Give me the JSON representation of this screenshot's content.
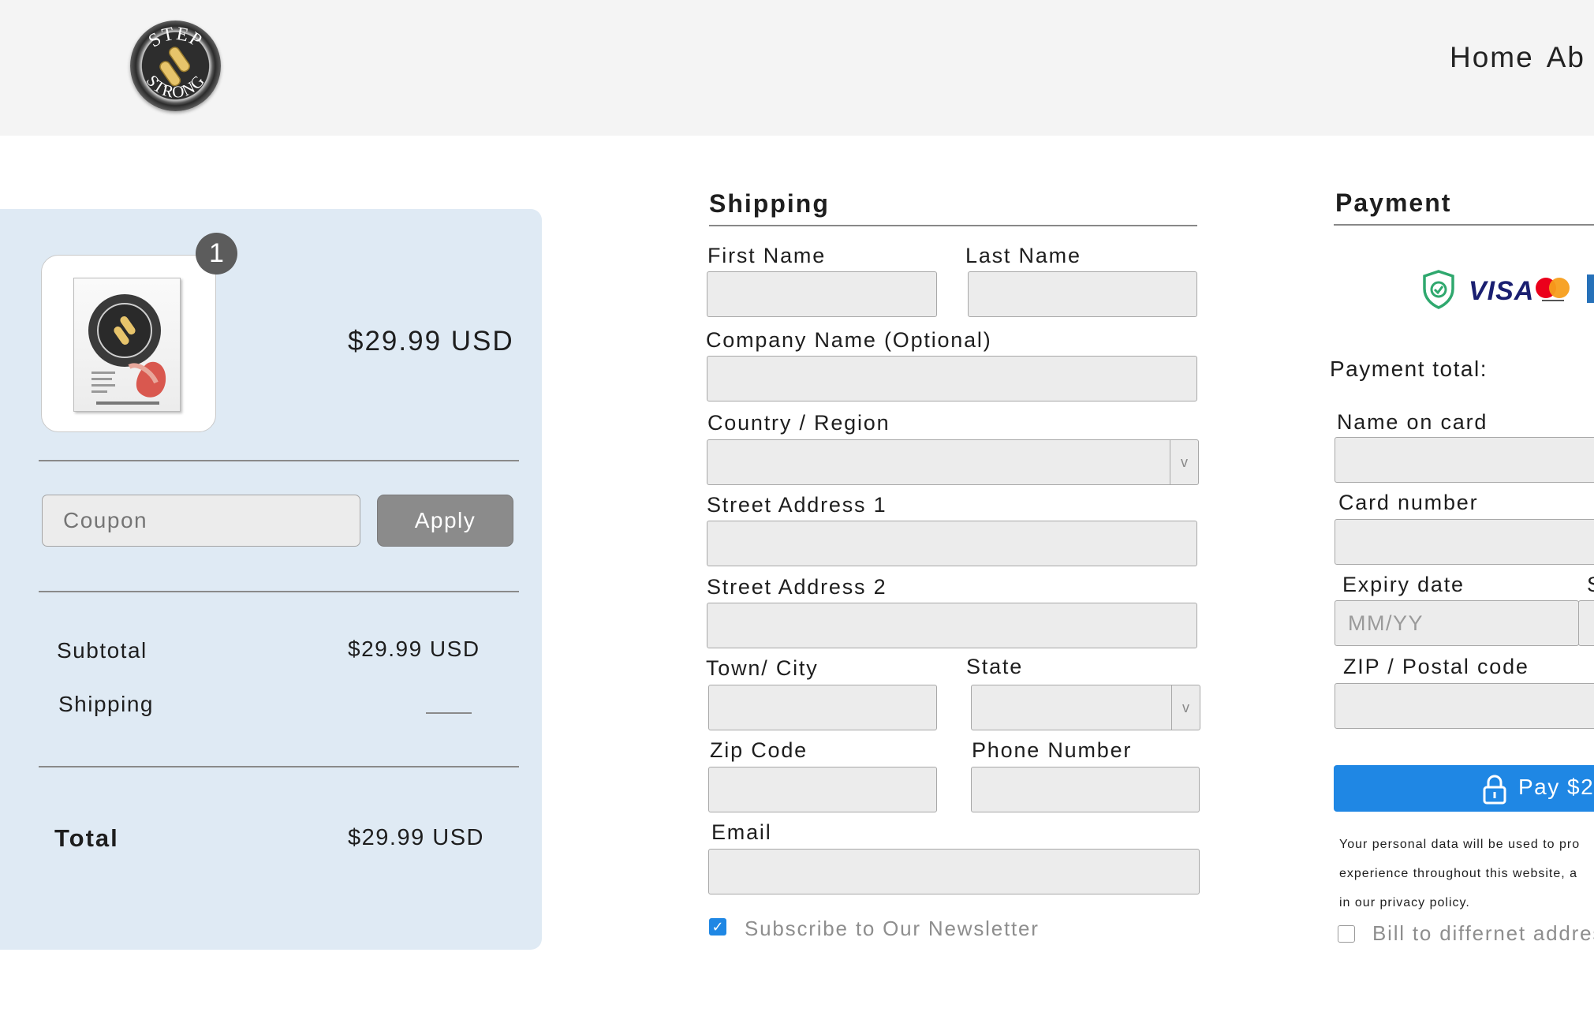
{
  "header": {
    "logo_text_top": "STEP",
    "logo_text_bottom": "STRONG",
    "nav": [
      "Home",
      "Ab"
    ]
  },
  "cart": {
    "item_count": "1",
    "product_price": "$29.99 USD",
    "coupon_placeholder": "Coupon",
    "apply_label": "Apply",
    "subtotal_label": "Subtotal",
    "subtotal_value": "$29.99 USD",
    "shipping_label": "Shipping",
    "total_label": "Total",
    "total_value": "$29.99 USD"
  },
  "shipping": {
    "title": "Shipping",
    "first_name": "First Name",
    "last_name": "Last Name",
    "company": "Company Name (Optional)",
    "country": "Country / Region",
    "street1": "Street Address 1",
    "street2": "Street Address 2",
    "city": "Town/ City",
    "state": "State",
    "zip": "Zip Code",
    "phone": "Phone Number",
    "email": "Email",
    "newsletter": "Subscribe to Our Newsletter",
    "select_arrow": "v"
  },
  "payment": {
    "title": "Payment",
    "visa": "VISA",
    "total_label": "Payment total:",
    "name_on_card": "Name on card",
    "card_number": "Card number",
    "expiry": "Expiry date",
    "expiry_placeholder": "MM/YY",
    "security_partial": "S",
    "zip": "ZIP / Postal code",
    "pay_label": "Pay $2",
    "privacy_lines": [
      "Your personal data will be used to pro",
      "experience throughout this website, a",
      "in our privacy policy."
    ],
    "bill_different": "Bill to differnet addres"
  },
  "colors": {
    "accent": "#1f87e4",
    "panel": "#dfeaf4",
    "header_bg": "#f4f4f4",
    "field_bg": "#ececec",
    "apply_bg": "#8b8b8b",
    "shield": "#2fa86e",
    "visa": "#1a1f71"
  },
  "icons": [
    "shield-check-icon",
    "visa-icon",
    "mastercard-icon",
    "amex-icon",
    "lock-icon",
    "checkmark-icon",
    "chevron-down-icon"
  ]
}
